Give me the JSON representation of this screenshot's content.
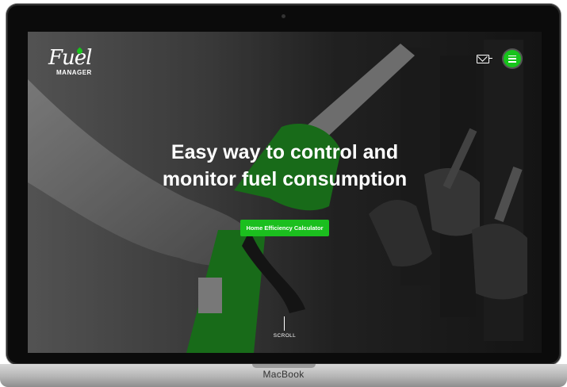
{
  "device": {
    "brand_label": "MacBook"
  },
  "header": {
    "logo": {
      "script_text": "Fuel",
      "sub_text": "MANAGER"
    },
    "mail_icon": "mail-icon",
    "menu_icon": "hamburger-menu-icon"
  },
  "hero": {
    "headline_line1": "Easy way to control and",
    "headline_line2": "monitor fuel consumption",
    "cta_label": "Home Efficiency Calculator",
    "scroll_label": "SCROLL"
  },
  "colors": {
    "accent": "#1bbf1e",
    "nozzle_green": "#1f8a20"
  }
}
